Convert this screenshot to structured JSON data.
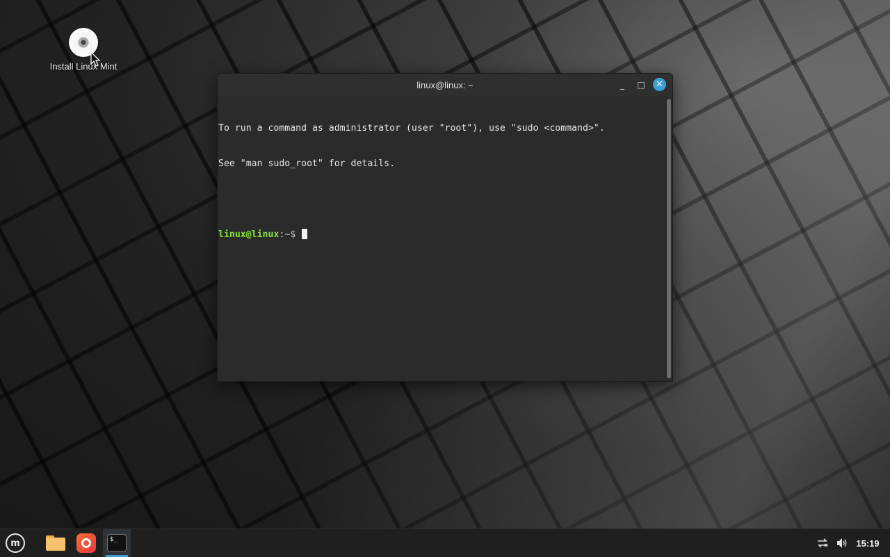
{
  "desktop": {
    "icons": [
      {
        "label": "Install Linux Mint",
        "icon": "disc-icon"
      }
    ]
  },
  "terminal": {
    "title": "linux@linux: ~",
    "lines": [
      "To run a command as administrator (user \"root\"), use \"sudo <command>\".",
      "See \"man sudo_root\" for details."
    ],
    "prompt_user": "linux@linux",
    "prompt_path": ":~$",
    "window_buttons": {
      "minimize": "_",
      "maximize": "□",
      "close": "✕"
    }
  },
  "taskbar": {
    "menu_icon": "linux-mint-menu-icon",
    "menu_logo_text": "m",
    "launchers": [
      {
        "name": "files",
        "icon": "folder-icon"
      },
      {
        "name": "web-browser",
        "icon": "browser-icon"
      },
      {
        "name": "terminal",
        "icon": "terminal-icon",
        "active": true
      }
    ],
    "terminal_icon_text": "$_",
    "tray": {
      "network_icon": "network-disconnected-icon",
      "volume_icon": "volume-icon",
      "clock": "15:19"
    }
  },
  "colors": {
    "accent": "#3a9fd4",
    "prompt_green": "#8ae234",
    "terminal_bg": "#2b2b2b",
    "taskbar_bg": "#1f1f1f"
  }
}
